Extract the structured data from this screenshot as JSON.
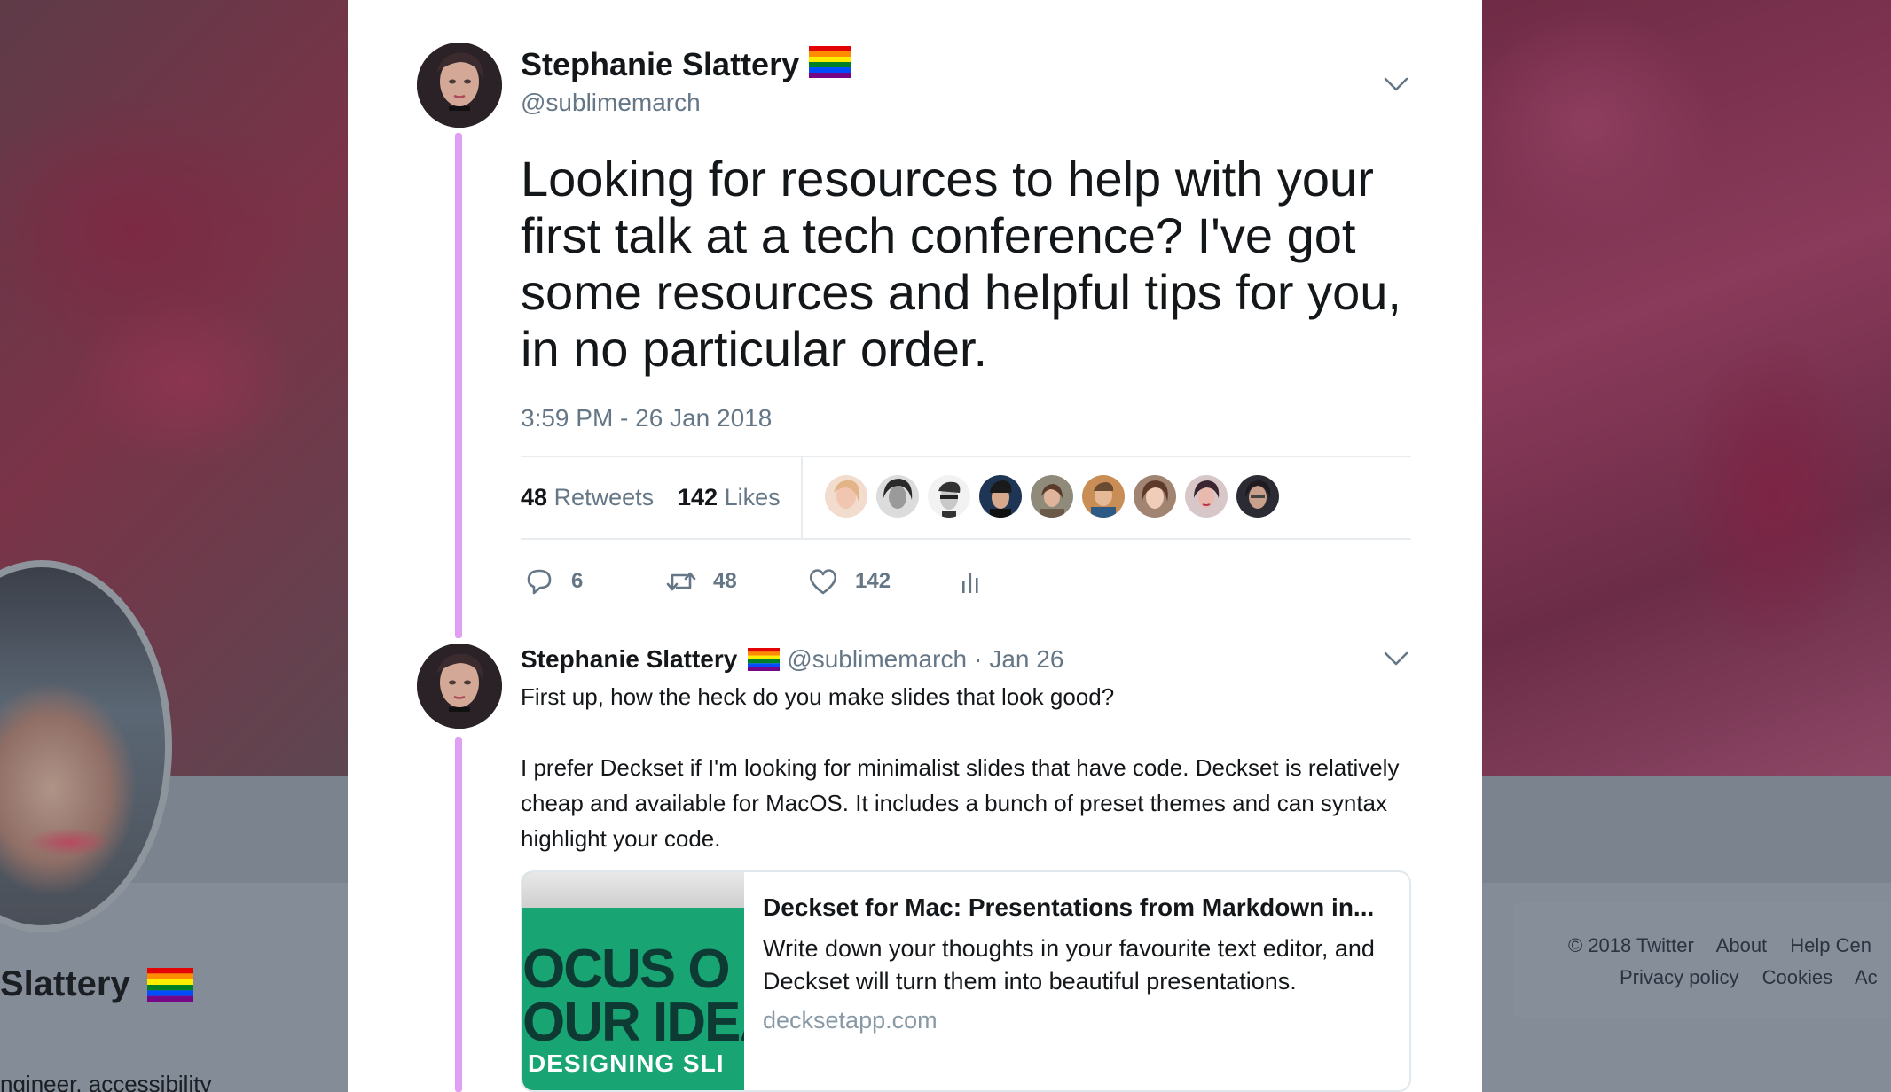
{
  "background": {
    "profile_name": "Slattery",
    "profile_bio_fragment": "ngineer, accessibility",
    "footer": {
      "row1": [
        "© 2018 Twitter",
        "About",
        "Help Cen"
      ],
      "row2": [
        "Privacy policy",
        "Cookies",
        "Ac"
      ]
    }
  },
  "tweet": {
    "display_name": "Stephanie Slattery",
    "handle": "@sublimemarch",
    "text": "Looking for resources to help with your first talk at a tech conference? I've got some resources and helpful tips for you, in no particular order.",
    "timestamp": "3:59 PM - 26 Jan 2018",
    "stats": {
      "retweets_count": "48",
      "retweets_label": "Retweets",
      "likes_count": "142",
      "likes_label": "Likes"
    },
    "likers_count": 9,
    "actions": {
      "reply_count": "6",
      "retweet_count": "48",
      "like_count": "142"
    }
  },
  "reply": {
    "display_name": "Stephanie Slattery",
    "handle": "@sublimemarch",
    "separator": "·",
    "date": "Jan 26",
    "paragraph1": "First up, how the heck do you make slides that look good?",
    "paragraph2": "I prefer Deckset if I'm looking for minimalist slides that have code. Deckset is relatively cheap and available for MacOS. It includes a bunch of preset themes and can syntax highlight your code.",
    "card": {
      "title": "Deckset for Mac: Presentations from Markdown in...",
      "description": "Write down your thoughts in your favourite text editor, and Deckset will turn them into beautiful presentations.",
      "domain": "decksetapp.com",
      "image_text_1": "OCUS O",
      "image_text_2": "OUR IDEA",
      "image_text_3": "DESIGNING SLI"
    }
  },
  "colors": {
    "thread_line": "#e09ff3",
    "secondary_text": "#657786",
    "primary_text": "#14171a",
    "card_green": "#18a573"
  },
  "icons": {
    "reply": "speech-bubble-icon",
    "retweet": "retweet-arrows-icon",
    "like": "heart-icon",
    "analytics": "bar-chart-icon",
    "caret": "chevron-down-icon",
    "flag": "rainbow-flag-icon"
  }
}
